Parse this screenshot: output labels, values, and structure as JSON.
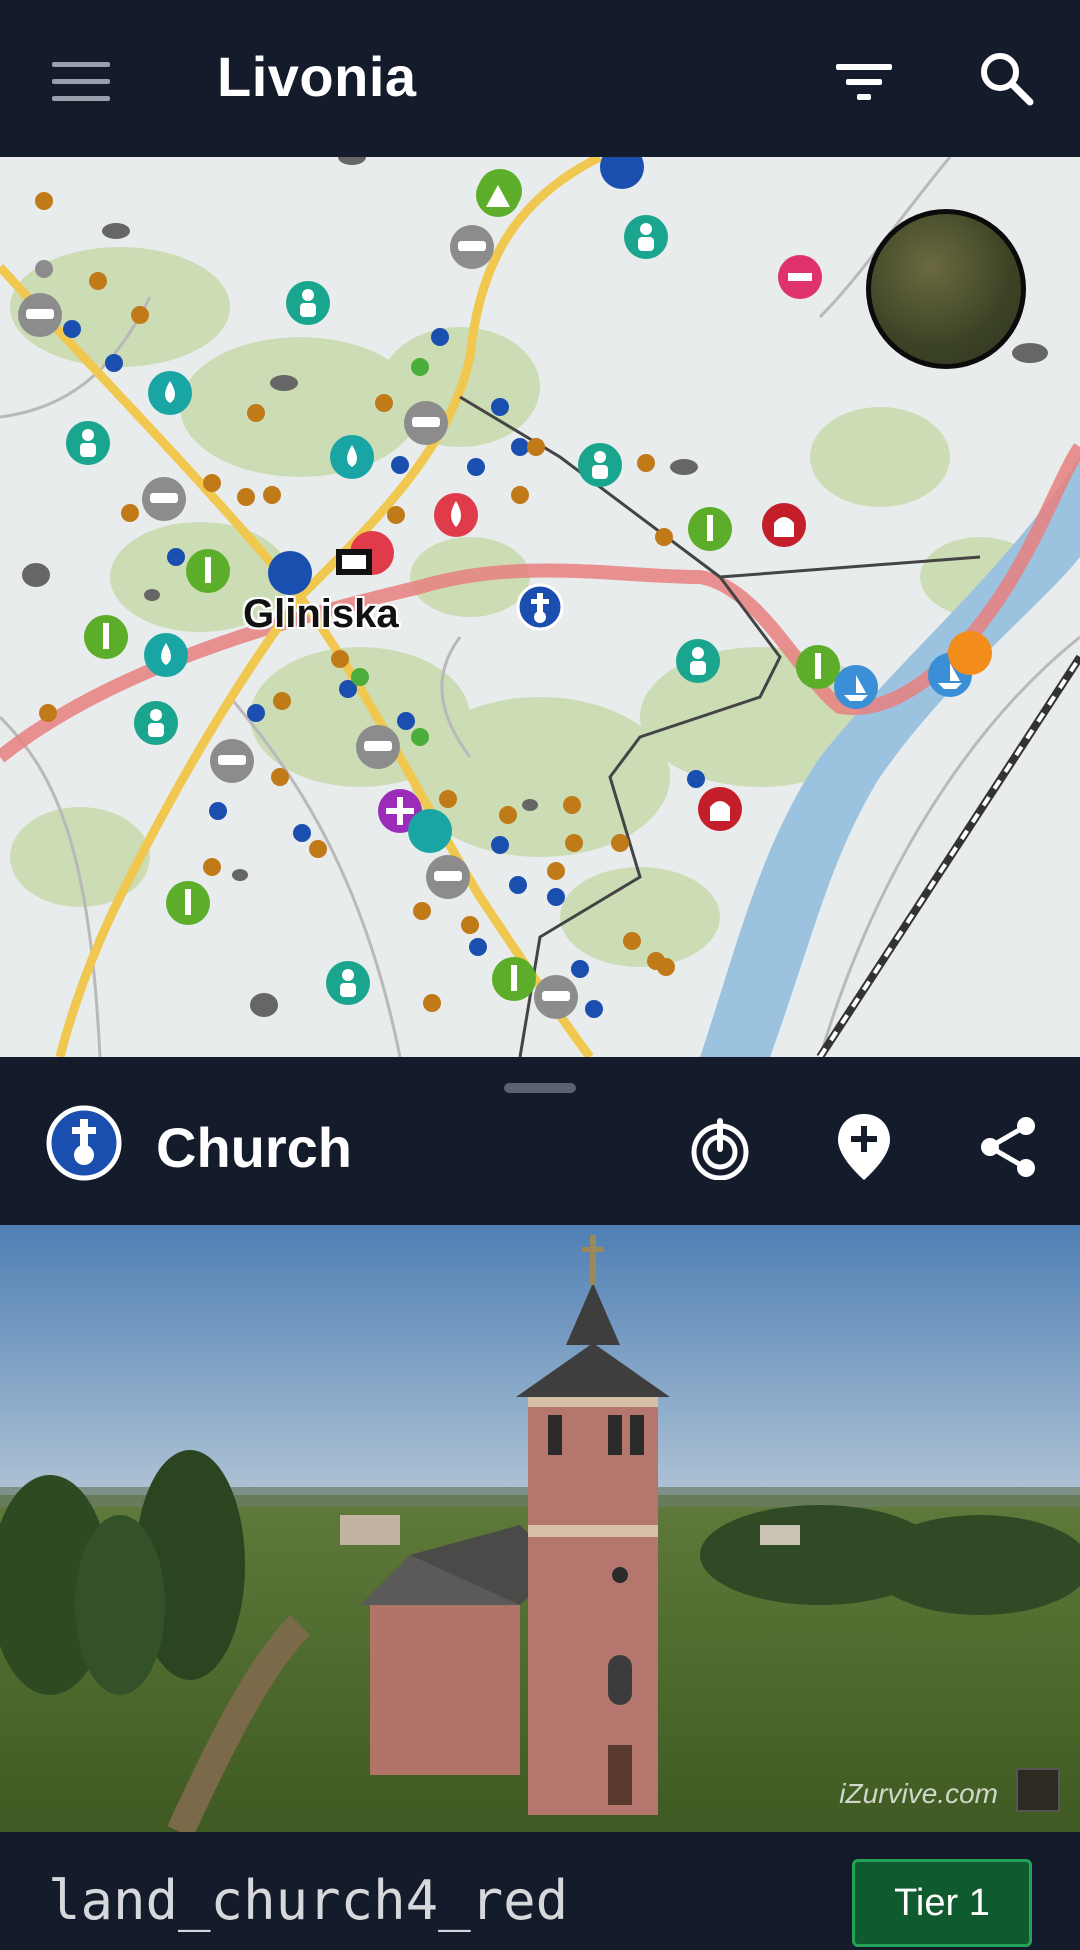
{
  "app_bar": {
    "title": "Livonia",
    "menu_icon": "menu-icon",
    "filter_icon": "filter-icon",
    "search_icon": "search-icon"
  },
  "map": {
    "town_label": "Gliniska",
    "minimap": "satellite-minimap"
  },
  "detail": {
    "title": "Church",
    "icon": "church-icon",
    "actions": [
      "locate-icon",
      "add-marker-icon",
      "share-icon"
    ],
    "photo_watermark": "iZurvive.com",
    "class_name": "land_church4_red",
    "tier_label": "Tier 1"
  },
  "colors": {
    "appbar_bg": "#141b2b",
    "map_bg": "#e9ecec",
    "river": "#9bc3df",
    "road_main": "#f0c850",
    "road_red": "#e88080",
    "tier_bg": "#0f5a2f",
    "tier_border": "#23a35a"
  }
}
